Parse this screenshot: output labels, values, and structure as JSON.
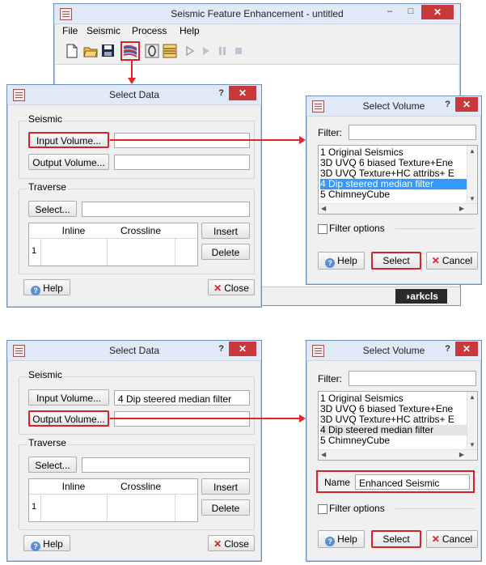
{
  "main_window": {
    "title": "Seismic Feature Enhancement - untitled",
    "min_symbol": "–",
    "max_symbol": "□",
    "close_symbol": "✕",
    "menu": [
      "File",
      "Seismic",
      "Process",
      "Help"
    ],
    "toolbar_icons": [
      "new-file-icon",
      "open-folder-icon",
      "save-icon",
      "seismic-data-icon",
      "attribute-icon",
      "horizon-icon",
      "play-icon",
      "step-icon",
      "pause-icon",
      "stop-icon"
    ],
    "logo_text": "arkcls"
  },
  "select_data_1": {
    "title": "Select Data",
    "help_q": "?",
    "seismic_label": "Seismic",
    "input_volume_btn": "Input Volume...",
    "input_value": "",
    "output_volume_btn": "Output Volume...",
    "output_value": "",
    "traverse_label": "Traverse",
    "select_btn": "Select...",
    "select_value": "",
    "table_headers": [
      "Inline",
      "Crossline"
    ],
    "row_number": "1",
    "insert_btn": "Insert",
    "delete_btn": "Delete",
    "help_btn": "Help",
    "close_btn": "Close"
  },
  "select_volume_1": {
    "title": "Select Volume",
    "help_q": "?",
    "filter_label": "Filter:",
    "filter_value": "",
    "items": [
      "1 Original Seismics",
      "3D UVQ 6 biased Texture+Ene",
      "3D UVQ Texture+HC attribs+ E",
      "4 Dip steered median filter",
      "5 ChimneyCube"
    ],
    "selected_index": 3,
    "filter_options": "Filter options",
    "help_btn": "Help",
    "select_btn": "Select",
    "cancel_btn": "Cancel"
  },
  "select_data_2": {
    "title": "Select Data",
    "help_q": "?",
    "seismic_label": "Seismic",
    "input_volume_btn": "Input Volume...",
    "input_value": "4 Dip steered median filter",
    "output_volume_btn": "Output Volume...",
    "output_value": "",
    "traverse_label": "Traverse",
    "select_btn": "Select...",
    "select_value": "",
    "table_headers": [
      "Inline",
      "Crossline"
    ],
    "row_number": "1",
    "insert_btn": "Insert",
    "delete_btn": "Delete",
    "help_btn": "Help",
    "close_btn": "Close"
  },
  "select_volume_2": {
    "title": "Select Volume",
    "help_q": "?",
    "filter_label": "Filter:",
    "filter_value": "",
    "items": [
      "1 Original Seismics",
      "3D UVQ 6 biased Texture+Ene",
      "3D UVQ Texture+HC attribs+ E",
      "4 Dip steered median filter",
      "5 ChimneyCube"
    ],
    "selected_index": 3,
    "name_label": "Name",
    "name_value": "Enhanced Seismic",
    "filter_options": "Filter options",
    "help_btn": "Help",
    "select_btn": "Select",
    "cancel_btn": "Cancel"
  },
  "colors": {
    "highlight_red": "#d72027",
    "selection_blue": "#3399ff",
    "title_bar": "#dfe9f7"
  }
}
